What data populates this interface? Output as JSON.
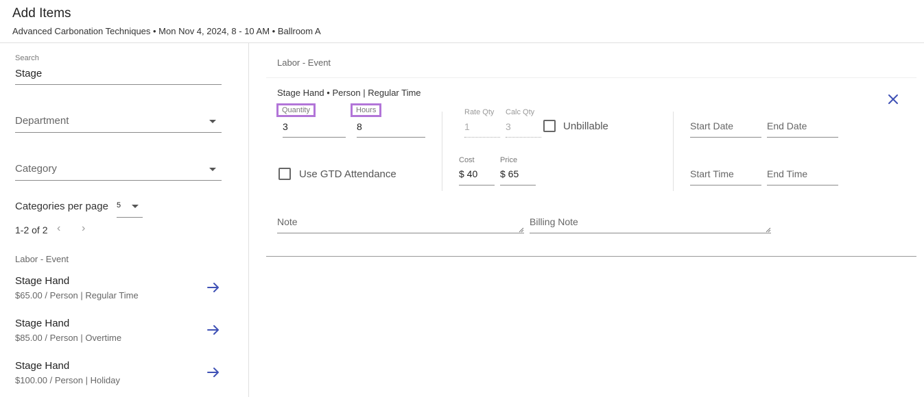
{
  "header": {
    "title": "Add Items",
    "subtitle": "Advanced Carbonation Techniques • Mon Nov 4, 2024, 8 - 10 AM • Ballroom A"
  },
  "sidebar": {
    "search": {
      "label": "Search",
      "value": "Stage"
    },
    "department": {
      "placeholder": "Department"
    },
    "category": {
      "placeholder": "Category"
    },
    "per_page": {
      "label": "Categories per page",
      "value": "5"
    },
    "pagination": {
      "range": "1-2 of 2"
    },
    "group_label": "Labor - Event",
    "items": [
      {
        "name": "Stage Hand",
        "desc": "$65.00 / Person | Regular Time"
      },
      {
        "name": "Stage Hand",
        "desc": "$85.00 / Person | Overtime"
      },
      {
        "name": "Stage Hand",
        "desc": "$100.00 / Person | Holiday"
      }
    ]
  },
  "main": {
    "group_label": "Labor - Event",
    "line_item": {
      "title": "Stage Hand • Person | Regular Time",
      "quantity": {
        "label": "Quantity",
        "value": "3"
      },
      "hours": {
        "label": "Hours",
        "value": "8"
      },
      "rate_qty": {
        "label": "Rate Qty",
        "value": "1"
      },
      "calc_qty": {
        "label": "Calc Qty",
        "value": "3"
      },
      "unbillable": "Unbillable",
      "use_gtd": "Use GTD Attendance",
      "cost": {
        "label": "Cost",
        "value": "$ 40"
      },
      "price": {
        "label": "Price",
        "value": "$ 65"
      },
      "start_date": "Start Date",
      "end_date": "End Date",
      "start_time": "Start Time",
      "end_time": "End Time",
      "note": "Note",
      "billing_note": "Billing Note"
    }
  },
  "colors": {
    "accent": "#3f51b5",
    "highlight_border": "#b275d8"
  }
}
